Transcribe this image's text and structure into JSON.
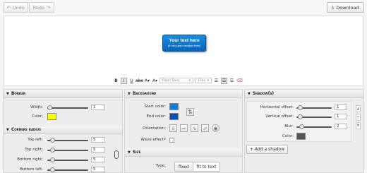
{
  "toolbar": {
    "undo_label": "Undo",
    "redo_label": "Redo",
    "download_label": "Download"
  },
  "preview": {
    "text_main": "Your text here",
    "text_sub": "(it can span multiple lines)",
    "button_bg": "#0b72cc",
    "text_color": "#ffffff"
  },
  "formatbar": {
    "font": "Open Sans",
    "size": "12px"
  },
  "border": {
    "title": "Border",
    "width_label": "Width:",
    "width_value": "1",
    "color_label": "Color:",
    "color": "#ffff00"
  },
  "corners": {
    "title": "Corners radius",
    "items": [
      {
        "label": "Top left:",
        "value": "5"
      },
      {
        "label": "Top right:",
        "value": "5"
      },
      {
        "label": "Bottom right:",
        "value": "5"
      },
      {
        "label": "Bottom left:",
        "value": "5"
      }
    ]
  },
  "background": {
    "title": "Background",
    "start_label": "Start color:",
    "start_color": "#0a7ee0",
    "end_label": "End color:",
    "end_color": "#0550b5",
    "orientation_label": "Orientation:",
    "wave_label": "Wave effect?"
  },
  "size": {
    "title": "Size",
    "type_label": "Type:",
    "opt_fixed": "fixed",
    "opt_fit": "fit to text"
  },
  "shadows": {
    "title": "Shadow(s)",
    "items": [
      {
        "label": "Horizontal offset:",
        "value": "1"
      },
      {
        "label": "Vertical offset:",
        "value": "1"
      },
      {
        "label": "Blur:",
        "value": "2"
      }
    ],
    "color_label": "Color:",
    "color": "#555555",
    "add_label": "Add a shadow"
  }
}
